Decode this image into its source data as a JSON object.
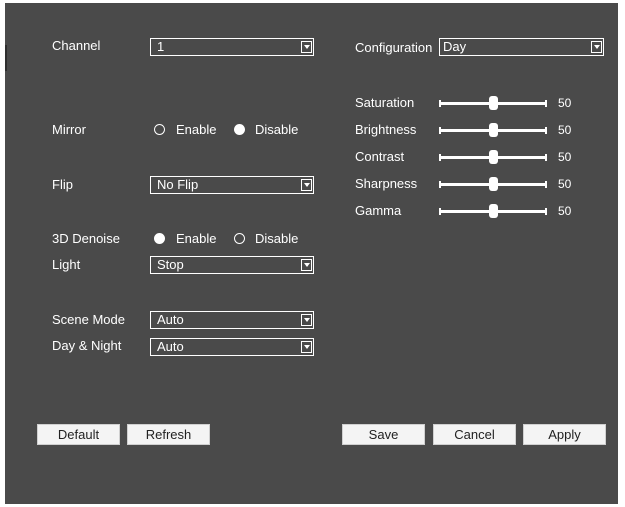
{
  "colors": {
    "panel_bg": "#4a4a4a",
    "text": "#ffffff",
    "button_bg": "#f4f4f4",
    "button_text": "#222222"
  },
  "left": {
    "channel": {
      "label": "Channel",
      "value": "1"
    },
    "mirror": {
      "label": "Mirror",
      "option_enable": "Enable",
      "option_disable": "Disable",
      "selected": "Disable"
    },
    "flip": {
      "label": "Flip",
      "value": "No Flip"
    },
    "denoise": {
      "label": "3D Denoise",
      "option_enable": "Enable",
      "option_disable": "Disable",
      "selected": "Enable"
    },
    "light": {
      "label": "Light",
      "value": "Stop"
    },
    "scene_mode": {
      "label": "Scene Mode",
      "value": "Auto"
    },
    "day_night": {
      "label": "Day & Night",
      "value": "Auto"
    }
  },
  "right": {
    "configuration": {
      "label": "Configuration",
      "value": "Day"
    },
    "sliders": [
      {
        "label": "Saturation",
        "value": 50,
        "max": 100,
        "display": "50"
      },
      {
        "label": "Brightness",
        "value": 50,
        "max": 100,
        "display": "50"
      },
      {
        "label": "Contrast",
        "value": 50,
        "max": 100,
        "display": "50"
      },
      {
        "label": "Sharpness",
        "value": 50,
        "max": 100,
        "display": "50"
      },
      {
        "label": "Gamma",
        "value": 50,
        "max": 100,
        "display": "50"
      }
    ]
  },
  "buttons": {
    "default": "Default",
    "refresh": "Refresh",
    "save": "Save",
    "cancel": "Cancel",
    "apply": "Apply"
  }
}
